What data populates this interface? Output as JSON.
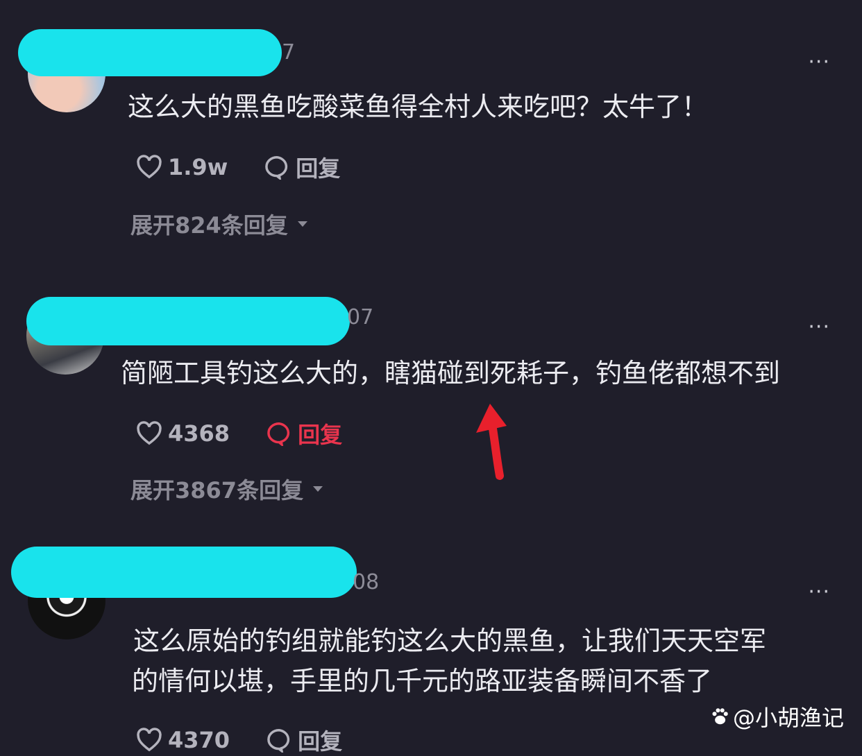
{
  "comments": [
    {
      "date_fragment": "7",
      "text_lines": [
        "这么大的黑鱼吃酸菜鱼得全村人来吃吧？太牛了！"
      ],
      "likes": "1.9w",
      "reply_label": "回复",
      "expand_label": "展开824条回复",
      "more": "···"
    },
    {
      "date_fragment": "07",
      "text_lines": [
        "简陋工具钓这么大的，瞎猫碰到死耗子，钓鱼佬都想不到"
      ],
      "likes": "4368",
      "reply_label": "回复",
      "expand_label": "展开3867条回复",
      "more": "···"
    },
    {
      "date_fragment": "08",
      "text_lines": [
        "这么原始的钓组就能钓这么大的黑鱼，让我们天天空军",
        "的情何以堪，手里的几千元的路亚装备瞬间不香了"
      ],
      "likes": "4370",
      "reply_label": "回复",
      "more": "···"
    }
  ],
  "watermark": "@小胡渔记",
  "colors": {
    "background": "#1f1e2a",
    "redaction": "#19e3ec",
    "reply_highlight": "#e9344d",
    "arrow": "#e8202c"
  },
  "icons": [
    "heart-icon",
    "comment-bubble-icon",
    "chevron-down-icon",
    "paw-icon",
    "arrow-up-icon"
  ]
}
